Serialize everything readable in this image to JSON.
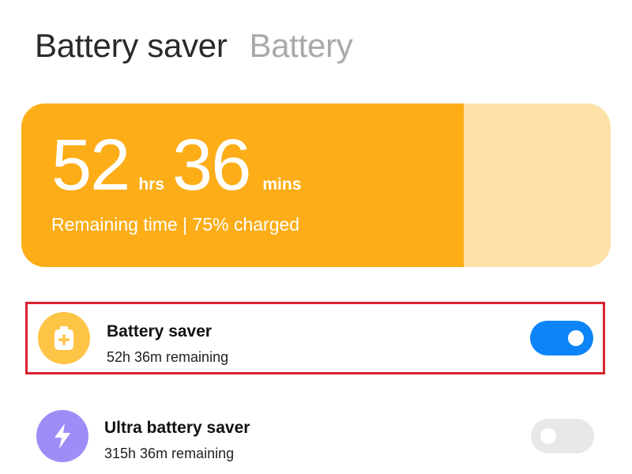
{
  "header": {
    "tabs": [
      {
        "label": "Battery saver",
        "active": true
      },
      {
        "label": "Battery",
        "active": false
      }
    ]
  },
  "battery_card": {
    "hours": "52",
    "hours_unit": "hrs",
    "minutes": "36",
    "minutes_unit": "mins",
    "remaining_text": "Remaining time | 75% charged",
    "charge_level": 0.75,
    "colors": {
      "fill": "#fcad17",
      "empty": "#fde2a7",
      "text": "#ffffff"
    }
  },
  "settings": [
    {
      "title": "Battery saver",
      "subtitle": "52h 36m remaining",
      "icon": "battery-plus-icon",
      "icon_color": "#fdc445",
      "toggle_on": true,
      "toggle_color": "#0d84f7",
      "highlighted": true,
      "highlight_color": "#d9232f"
    },
    {
      "title": "Ultra battery saver",
      "subtitle": "315h 36m remaining",
      "icon": "lightning-icon",
      "icon_color": "#a08cf6",
      "toggle_on": false,
      "toggle_color": "#e8e8e8",
      "highlighted": false
    }
  ]
}
